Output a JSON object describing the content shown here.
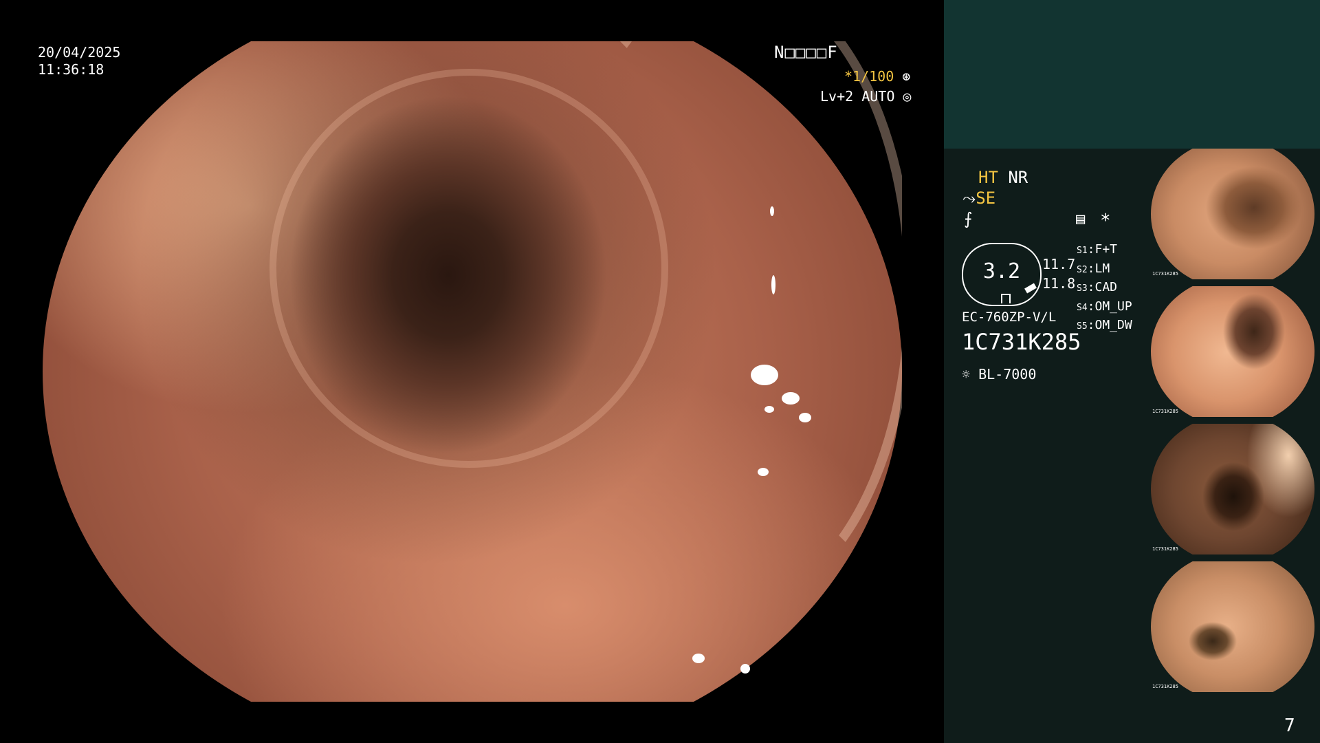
{
  "overlay": {
    "date": "20/04/2025",
    "time": "11:36:18",
    "patient_code": "N□□□□F",
    "shutter": "*1/100",
    "level": "Lv+2 AUTO"
  },
  "panel": {
    "mode_ht": "HT",
    "mode_nr": "NR",
    "mode_se": "SE",
    "asterisk": "*",
    "gauge_value": "3.2",
    "gauge_side_top": "11.7",
    "gauge_side_bottom": "11.8",
    "scope_model": "EC-760ZP-V/L",
    "serial": "1C731K285",
    "light_source": "BL-7000",
    "switches": [
      {
        "key": "S1",
        "value": "F+T"
      },
      {
        "key": "S2",
        "value": "LM"
      },
      {
        "key": "S3",
        "value": "CAD"
      },
      {
        "key": "S4",
        "value": "OM_UP"
      },
      {
        "key": "S5",
        "value": "OM_DW"
      }
    ]
  },
  "thumbnails": [
    {
      "label": "1C731K285"
    },
    {
      "label": "1C731K285"
    },
    {
      "label": "1C731K285"
    },
    {
      "label": "1C731K285"
    }
  ],
  "page_number": "7",
  "colors": {
    "panel_bg": "#0f1c1a",
    "panel_top_bg": "#123431",
    "accent_orange": "#f4c542"
  }
}
